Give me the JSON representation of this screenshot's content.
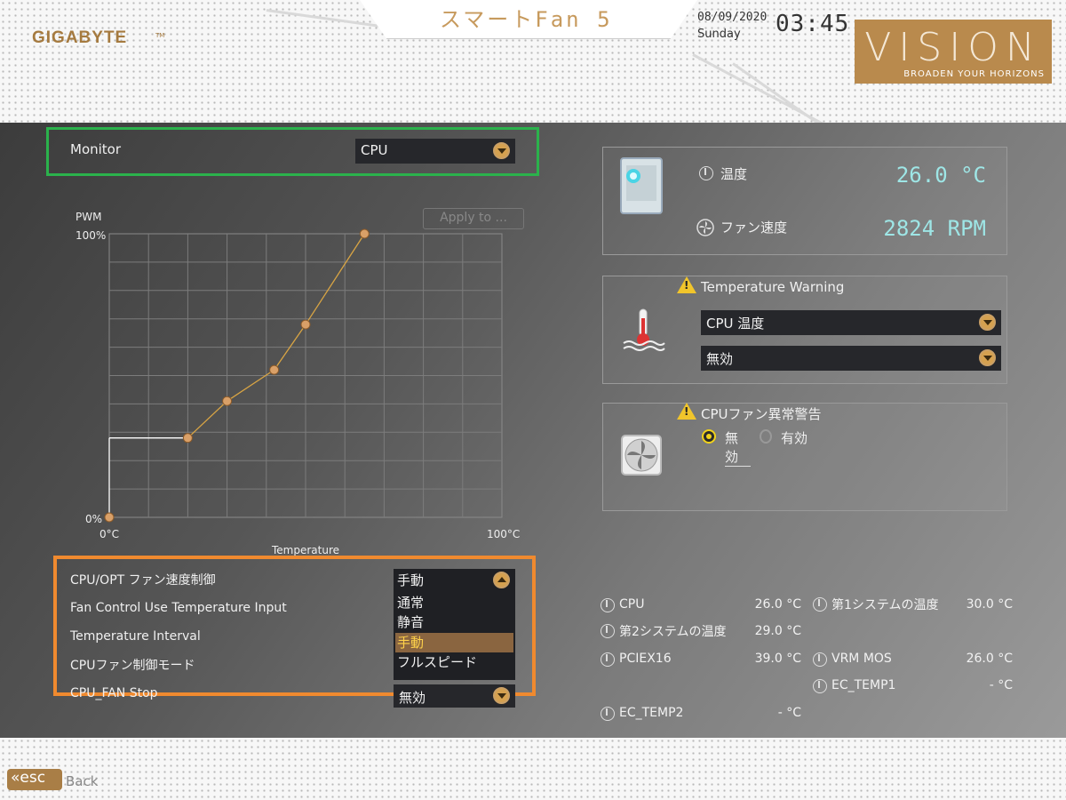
{
  "header": {
    "logo": "GIGABYTE",
    "logo_tm": "TM",
    "app_title": "スマートFan 5",
    "date": "08/09/2020",
    "weekday": "Sunday",
    "time": "03:45",
    "vision": {
      "word": "VISION",
      "tagline": "BROADEN YOUR HORIZONS"
    }
  },
  "monitor": {
    "label": "Monitor",
    "value": "CPU"
  },
  "chart": {
    "apply_label": "Apply to ...",
    "ylabel": "PWM",
    "xlabel": "Temperature",
    "ytick_max": "100%",
    "ytick_min": "0%",
    "xtick_min": "0°C",
    "xtick_max": "100°C"
  },
  "chart_data": {
    "type": "line",
    "x": [
      0,
      0,
      20,
      30,
      42,
      50,
      65
    ],
    "y": [
      0,
      28,
      28,
      41,
      52,
      68,
      100
    ],
    "xlim": [
      0,
      100
    ],
    "ylim": [
      0,
      100
    ],
    "xlabel": "Temperature",
    "ylabel": "PWM",
    "grid": true,
    "line_color": "#d9a544"
  },
  "fan_stats": {
    "temp_label": "温度",
    "temp_value": "26.0 °C",
    "speed_label": "ファン速度",
    "speed_value": "2824 RPM"
  },
  "temp_warning": {
    "title": "Temperature Warning",
    "source": "CPU 温度",
    "value": "無効"
  },
  "fan_fail": {
    "title": "CPUファン異常警告",
    "option_off": "無効",
    "option_on": "有効",
    "selected": "無効"
  },
  "settings": {
    "rows": [
      {
        "label": "CPU/OPT ファン速度制御"
      },
      {
        "label": "Fan Control Use Temperature Input"
      },
      {
        "label": "Temperature Interval"
      },
      {
        "label": "CPUファン制御モード"
      },
      {
        "label": "CPU_FAN Stop"
      }
    ],
    "speed_control_value": "手動",
    "fan_stop_value": "無効",
    "popup_options": [
      "通常",
      "静音",
      "手動",
      "フルスピード"
    ],
    "popup_selected": "手動"
  },
  "sensors": {
    "cpu": {
      "name": "CPU",
      "value": "26.0 °C"
    },
    "sys2": {
      "name": "第2システムの温度",
      "value": "29.0 °C"
    },
    "pciex16": {
      "name": "PCIEX16",
      "value": "39.0 °C"
    },
    "ec_temp2": {
      "name": "EC_TEMP2",
      "value": "- °C"
    },
    "sys1": {
      "name": "第1システムの温度",
      "value": "30.0 °C"
    },
    "vrm": {
      "name": "VRM MOS",
      "value": "26.0 °C"
    },
    "ec_temp1": {
      "name": "EC_TEMP1",
      "value": "- °C"
    }
  },
  "footer": {
    "esc_label": "esc",
    "back_label": "Back"
  }
}
